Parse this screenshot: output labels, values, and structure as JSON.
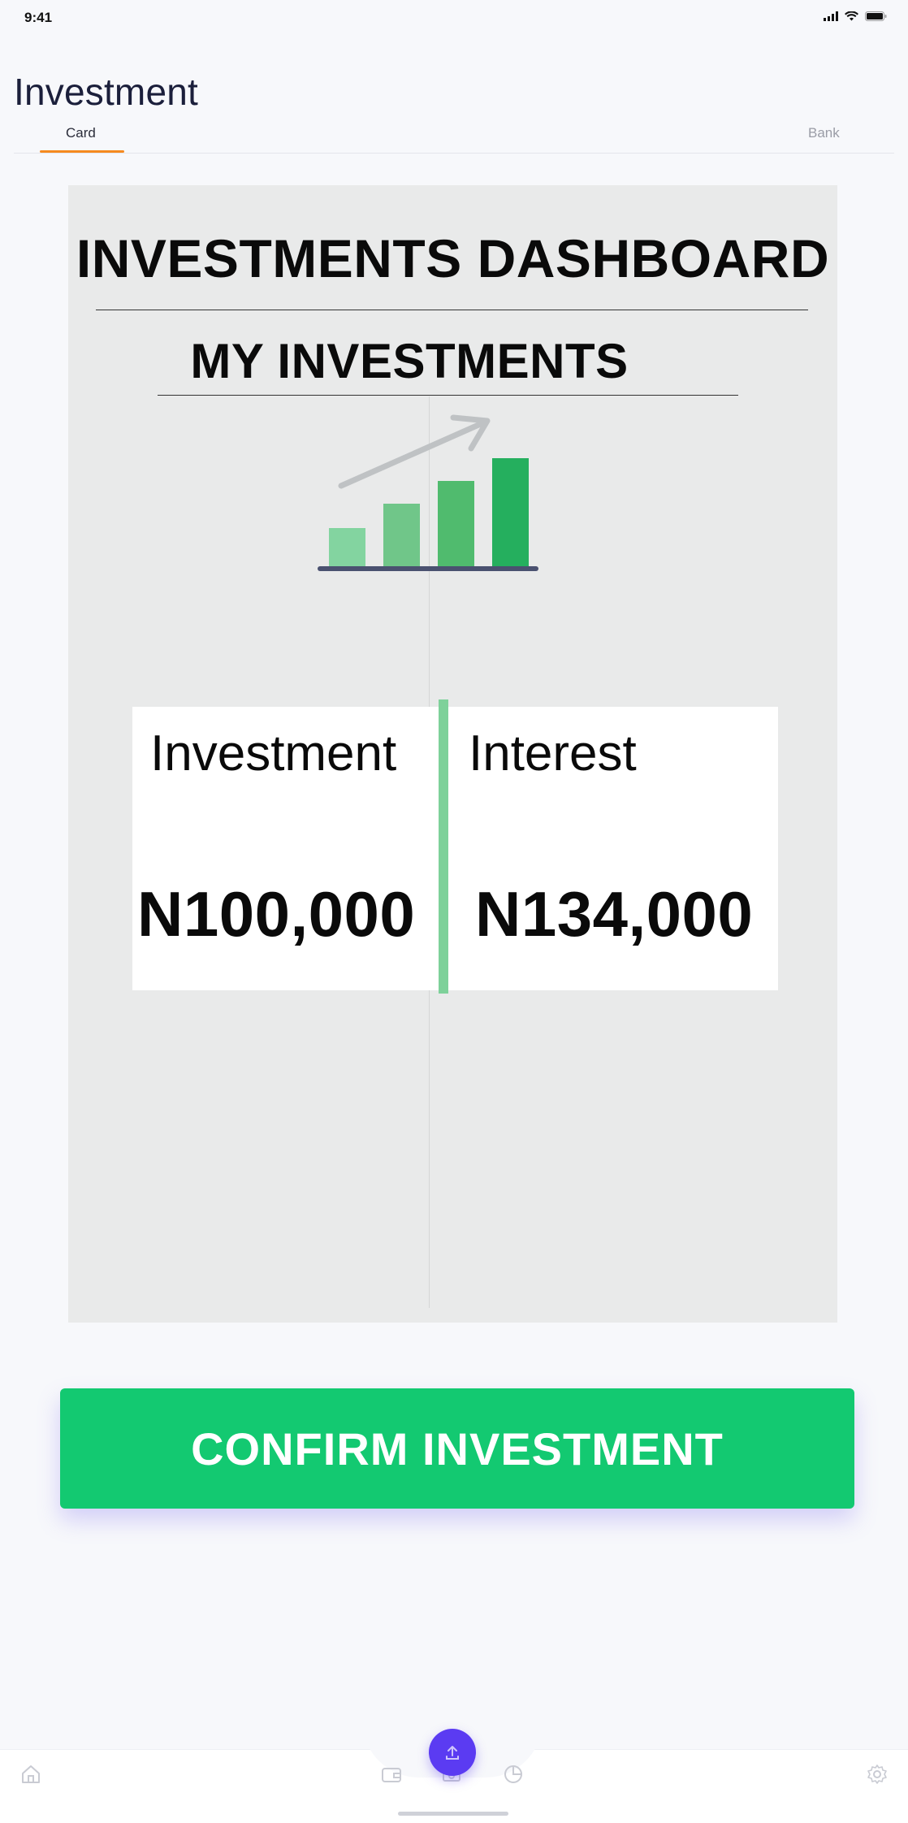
{
  "status_bar": {
    "time": "9:41"
  },
  "header": {
    "title": "Investment"
  },
  "tabs": [
    {
      "label": "Card",
      "active": true
    },
    {
      "label": "Bank",
      "active": false
    }
  ],
  "dashboard": {
    "title": "INVESTMENTS DASHBOARD",
    "subtitle": "MY INVESTMENTS",
    "icon": "bar-chart-growth-icon",
    "stats": {
      "investment_label": "Investment",
      "investment_value": "N100,000",
      "interest_label": "Interest",
      "interest_value": "N134,000"
    }
  },
  "actions": {
    "confirm_label": "CONFIRM INVESTMENT"
  },
  "bottom_nav": {
    "items": [
      "home-icon",
      "wallet-icon",
      "transfer-icon",
      "pie-chart-icon",
      "settings-icon"
    ]
  },
  "colors": {
    "accent_green": "#13C971",
    "tab_underline": "#F58A1F",
    "fab_purple": "#5B3BF2",
    "divider_green": "#7ED19A"
  }
}
